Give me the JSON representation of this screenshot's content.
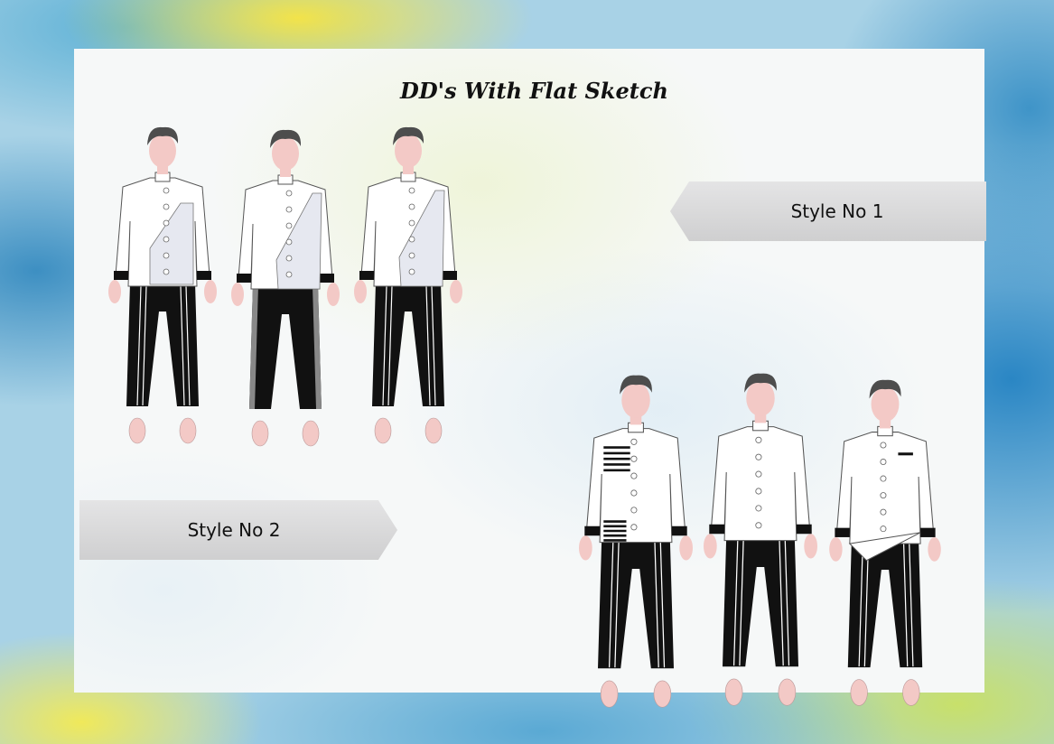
{
  "title": "DD's With Flat Sketch",
  "style1_label": "Style No 1",
  "style2_label": "Style No 2",
  "figures": [
    {
      "name": "figure-1",
      "shirt_panel": "apron"
    },
    {
      "name": "figure-2",
      "shirt_panel": "side-grey"
    },
    {
      "name": "figure-3",
      "shirt_panel": "diagonal"
    },
    {
      "name": "figure-4",
      "shirt_panel": "stripes"
    },
    {
      "name": "figure-5",
      "shirt_panel": "plain"
    },
    {
      "name": "figure-6",
      "shirt_panel": "asym-hem"
    }
  ],
  "colors": {
    "shirt": "#ffffff",
    "panel": "#e6e8f0",
    "trouser": "#111111",
    "skin": "#f3c9c6",
    "hair": "#4d4d4d"
  }
}
